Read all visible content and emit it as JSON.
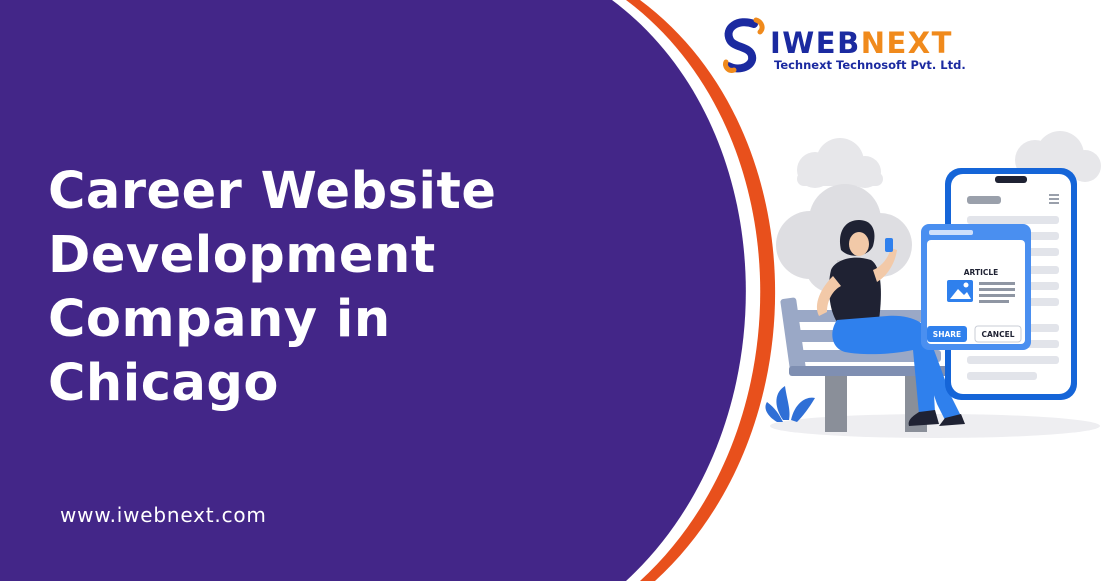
{
  "headline": {
    "lines": [
      "Career Website",
      "Development",
      "Company in",
      "Chicago"
    ]
  },
  "website_url": "www.iwebnext.com",
  "logo": {
    "word_part1": "IWEB",
    "word_part2": "NEXT",
    "tagline": "Technext Technosoft Pvt. Ltd."
  },
  "illustration": {
    "article_label": "ARTICLE",
    "share_label": "SHARE",
    "cancel_label": "CANCEL"
  },
  "colors": {
    "panel_purple": "#432688",
    "accent_orange": "#e8501c",
    "brand_blue": "#1b2aa0",
    "brand_orange": "#f08a1c",
    "ui_blue": "#2f80ed"
  }
}
